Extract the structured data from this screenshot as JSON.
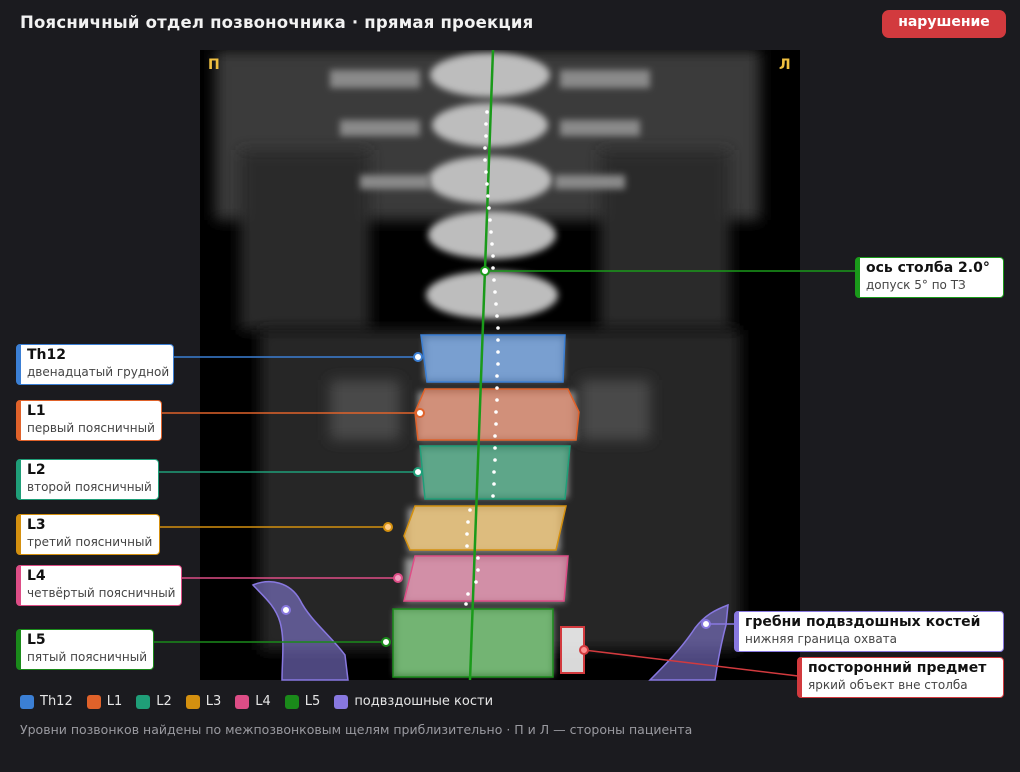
{
  "header": {
    "title": "Поясничный отдел позвоночника · прямая проекция",
    "status": "нарушение",
    "status_color": "#d23a3e"
  },
  "image": {
    "side_left": "П",
    "side_right": "Л"
  },
  "callouts": {
    "th12": {
      "title": "Th12",
      "sub": "двенадцатый грудной",
      "color": "#3b7fd4"
    },
    "l1": {
      "title": "L1",
      "sub": "первый поясничный",
      "color": "#e0622a"
    },
    "l2": {
      "title": "L2",
      "sub": "второй поясничный",
      "color": "#1f9e78"
    },
    "l3": {
      "title": "L3",
      "sub": "третий поясничный",
      "color": "#d4900f"
    },
    "l4": {
      "title": "L4",
      "sub": "четвёртый поясничный",
      "color": "#dd4d86"
    },
    "l5": {
      "title": "L5",
      "sub": "пятый поясничный",
      "color": "#1a8a1a"
    },
    "axis": {
      "title": "ось столба 2.0°",
      "sub": "допуск 5° по ТЗ",
      "color": "#1a9a1a"
    },
    "iliac": {
      "title": "гребни подвздошных костей",
      "sub": "нижняя граница охвата",
      "color": "#8878e0"
    },
    "foreign": {
      "title": "посторонний предмет",
      "sub": "яркий объект вне столба",
      "color": "#d23a3e"
    }
  },
  "legend": [
    {
      "label": "Th12",
      "color": "#3b7fd4"
    },
    {
      "label": "L1",
      "color": "#e0622a"
    },
    {
      "label": "L2",
      "color": "#1f9e78"
    },
    {
      "label": "L3",
      "color": "#d4900f"
    },
    {
      "label": "L4",
      "color": "#dd4d86"
    },
    {
      "label": "L5",
      "color": "#1a8a1a"
    },
    {
      "label": "подвздошные кости",
      "color": "#8878e0"
    }
  ],
  "footnote": "Уровни позвонков найдены по межпозвонковым щелям приблизительно · П и Л — стороны пациента"
}
